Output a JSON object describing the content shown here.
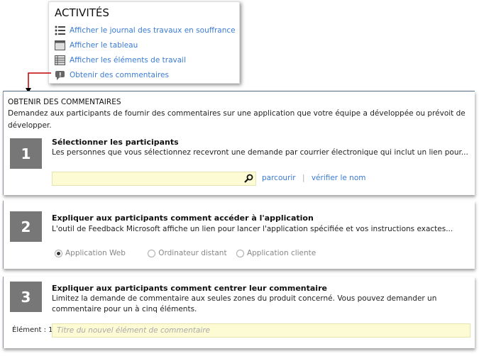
{
  "activities": {
    "title": "ACTIVITÉS",
    "items": [
      {
        "label": "Afficher le journal des travaux en souffrance",
        "icon": "backlog-list-icon"
      },
      {
        "label": "Afficher le tableau",
        "icon": "board-icon"
      },
      {
        "label": "Afficher les éléments de travail",
        "icon": "work-items-icon"
      },
      {
        "label": "Obtenir des commentaires",
        "icon": "feedback-icon"
      }
    ]
  },
  "accent": "#3a7bd5",
  "arrow_color": "#c00000",
  "panel1": {
    "title": "OBTENIR DES COMMENTAIRES",
    "description": "Demandez aux participants de fournir des commentaires sur une application que votre équipe a développée ou prévoit de développer.",
    "step": "1",
    "heading": "Sélectionner les participants",
    "text": "Les personnes que vous sélectionnez recevront une demande par courrier électronique qui inclut un lien pour...",
    "participants_value": "",
    "browse": "parcourir",
    "separator": "|",
    "check_name": "vérifier le nom"
  },
  "panel2": {
    "step": "2",
    "heading": "Expliquer aux participants comment accéder à l'application",
    "text": "L'outil de Feedback Microsoft affiche un lien pour lancer l'application spécifiée et vos instructions exactes...",
    "options": [
      "Application Web",
      "Ordinateur distant",
      "Application cliente"
    ],
    "selected": "Application Web"
  },
  "panel3": {
    "step": "3",
    "heading": "Expliquer aux participants comment centrer leur commentaire",
    "text": "Limitez la demande de commentaire aux seules zones du produit concerné. Vous pouvez demander un commentaire pour un à cinq éléments.",
    "item_label": "Élément : 1",
    "item_placeholder": "Titre du nouvel élément de commentaire"
  }
}
